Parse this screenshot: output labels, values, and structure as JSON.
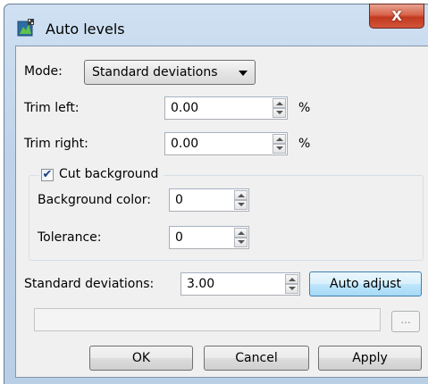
{
  "window": {
    "title": "Auto levels",
    "close_glyph": "X",
    "icon": "auto-levels-app-icon"
  },
  "mode": {
    "label": "Mode:",
    "selected": "Standard deviations"
  },
  "trim_left": {
    "label": "Trim left:",
    "value": "0.00",
    "unit": "%"
  },
  "trim_right": {
    "label": "Trim right:",
    "value": "0.00",
    "unit": "%"
  },
  "cut_background": {
    "label": "Cut background",
    "checked": true,
    "check_glyph": "✔",
    "background_color": {
      "label": "Background color:",
      "value": "0"
    },
    "tolerance": {
      "label": "Tolerance:",
      "value": "0"
    }
  },
  "standard_deviations": {
    "label": "Standard deviations:",
    "value": "3.00"
  },
  "auto_adjust_label": "Auto adjust",
  "browse_label": "...",
  "buttons": {
    "ok": "OK",
    "cancel": "Cancel",
    "apply": "Apply"
  },
  "colors": {
    "window_frame": "#bed3ea",
    "client_bg": "#f0f0f0",
    "close_button": "#c8452b",
    "default_button": "#bee6fd"
  }
}
